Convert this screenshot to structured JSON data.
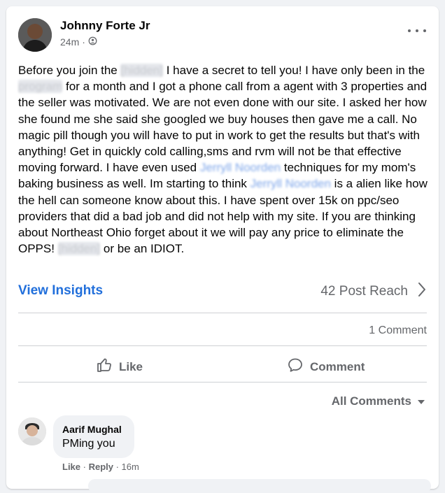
{
  "post": {
    "author": "Johnny Forte Jr",
    "time": "24m",
    "privacy_icon": "friends-icon",
    "text_parts": [
      "Before you join the ",
      "[hidden]",
      " I have a secret to tell you! I have only been in the ",
      "program",
      " for a month and I got a phone call from a agent with 3 properties and the seller was motivated. We are not even done with our site. I asked her how she found me she said she googled we buy houses then gave me a call. No magic pill though you will have to put in work to get the results but that's with anything! Get in quickly cold calling,sms and rvm will not be that effective moving forward. I have even used ",
      "Jerryll Noorden",
      " techniques for my mom's baking business as well. Im starting to think ",
      "Jerryll Noorden",
      " is a alien like how the hell can someone know about this. I have spent over 15k on ppc/seo providers that did a bad job and did not help with my site. If you are thinking about Northeast Ohio forget about it we will pay any price to eliminate the OPPS! ",
      "[hidden]",
      " or be an IDIOT."
    ]
  },
  "insights": {
    "view_label": "View Insights",
    "reach_label": "42 Post Reach"
  },
  "stats": {
    "comment_count": "1 Comment"
  },
  "actions": {
    "like": "Like",
    "comment": "Comment"
  },
  "comments_filter": "All Comments",
  "comment": {
    "author": "Aarif Mughal",
    "text": "PMing you",
    "like": "Like",
    "separator": " · ",
    "reply": "Reply",
    "time": "16m"
  },
  "colors": {
    "link": "#216fdb",
    "muted": "#65676b"
  }
}
